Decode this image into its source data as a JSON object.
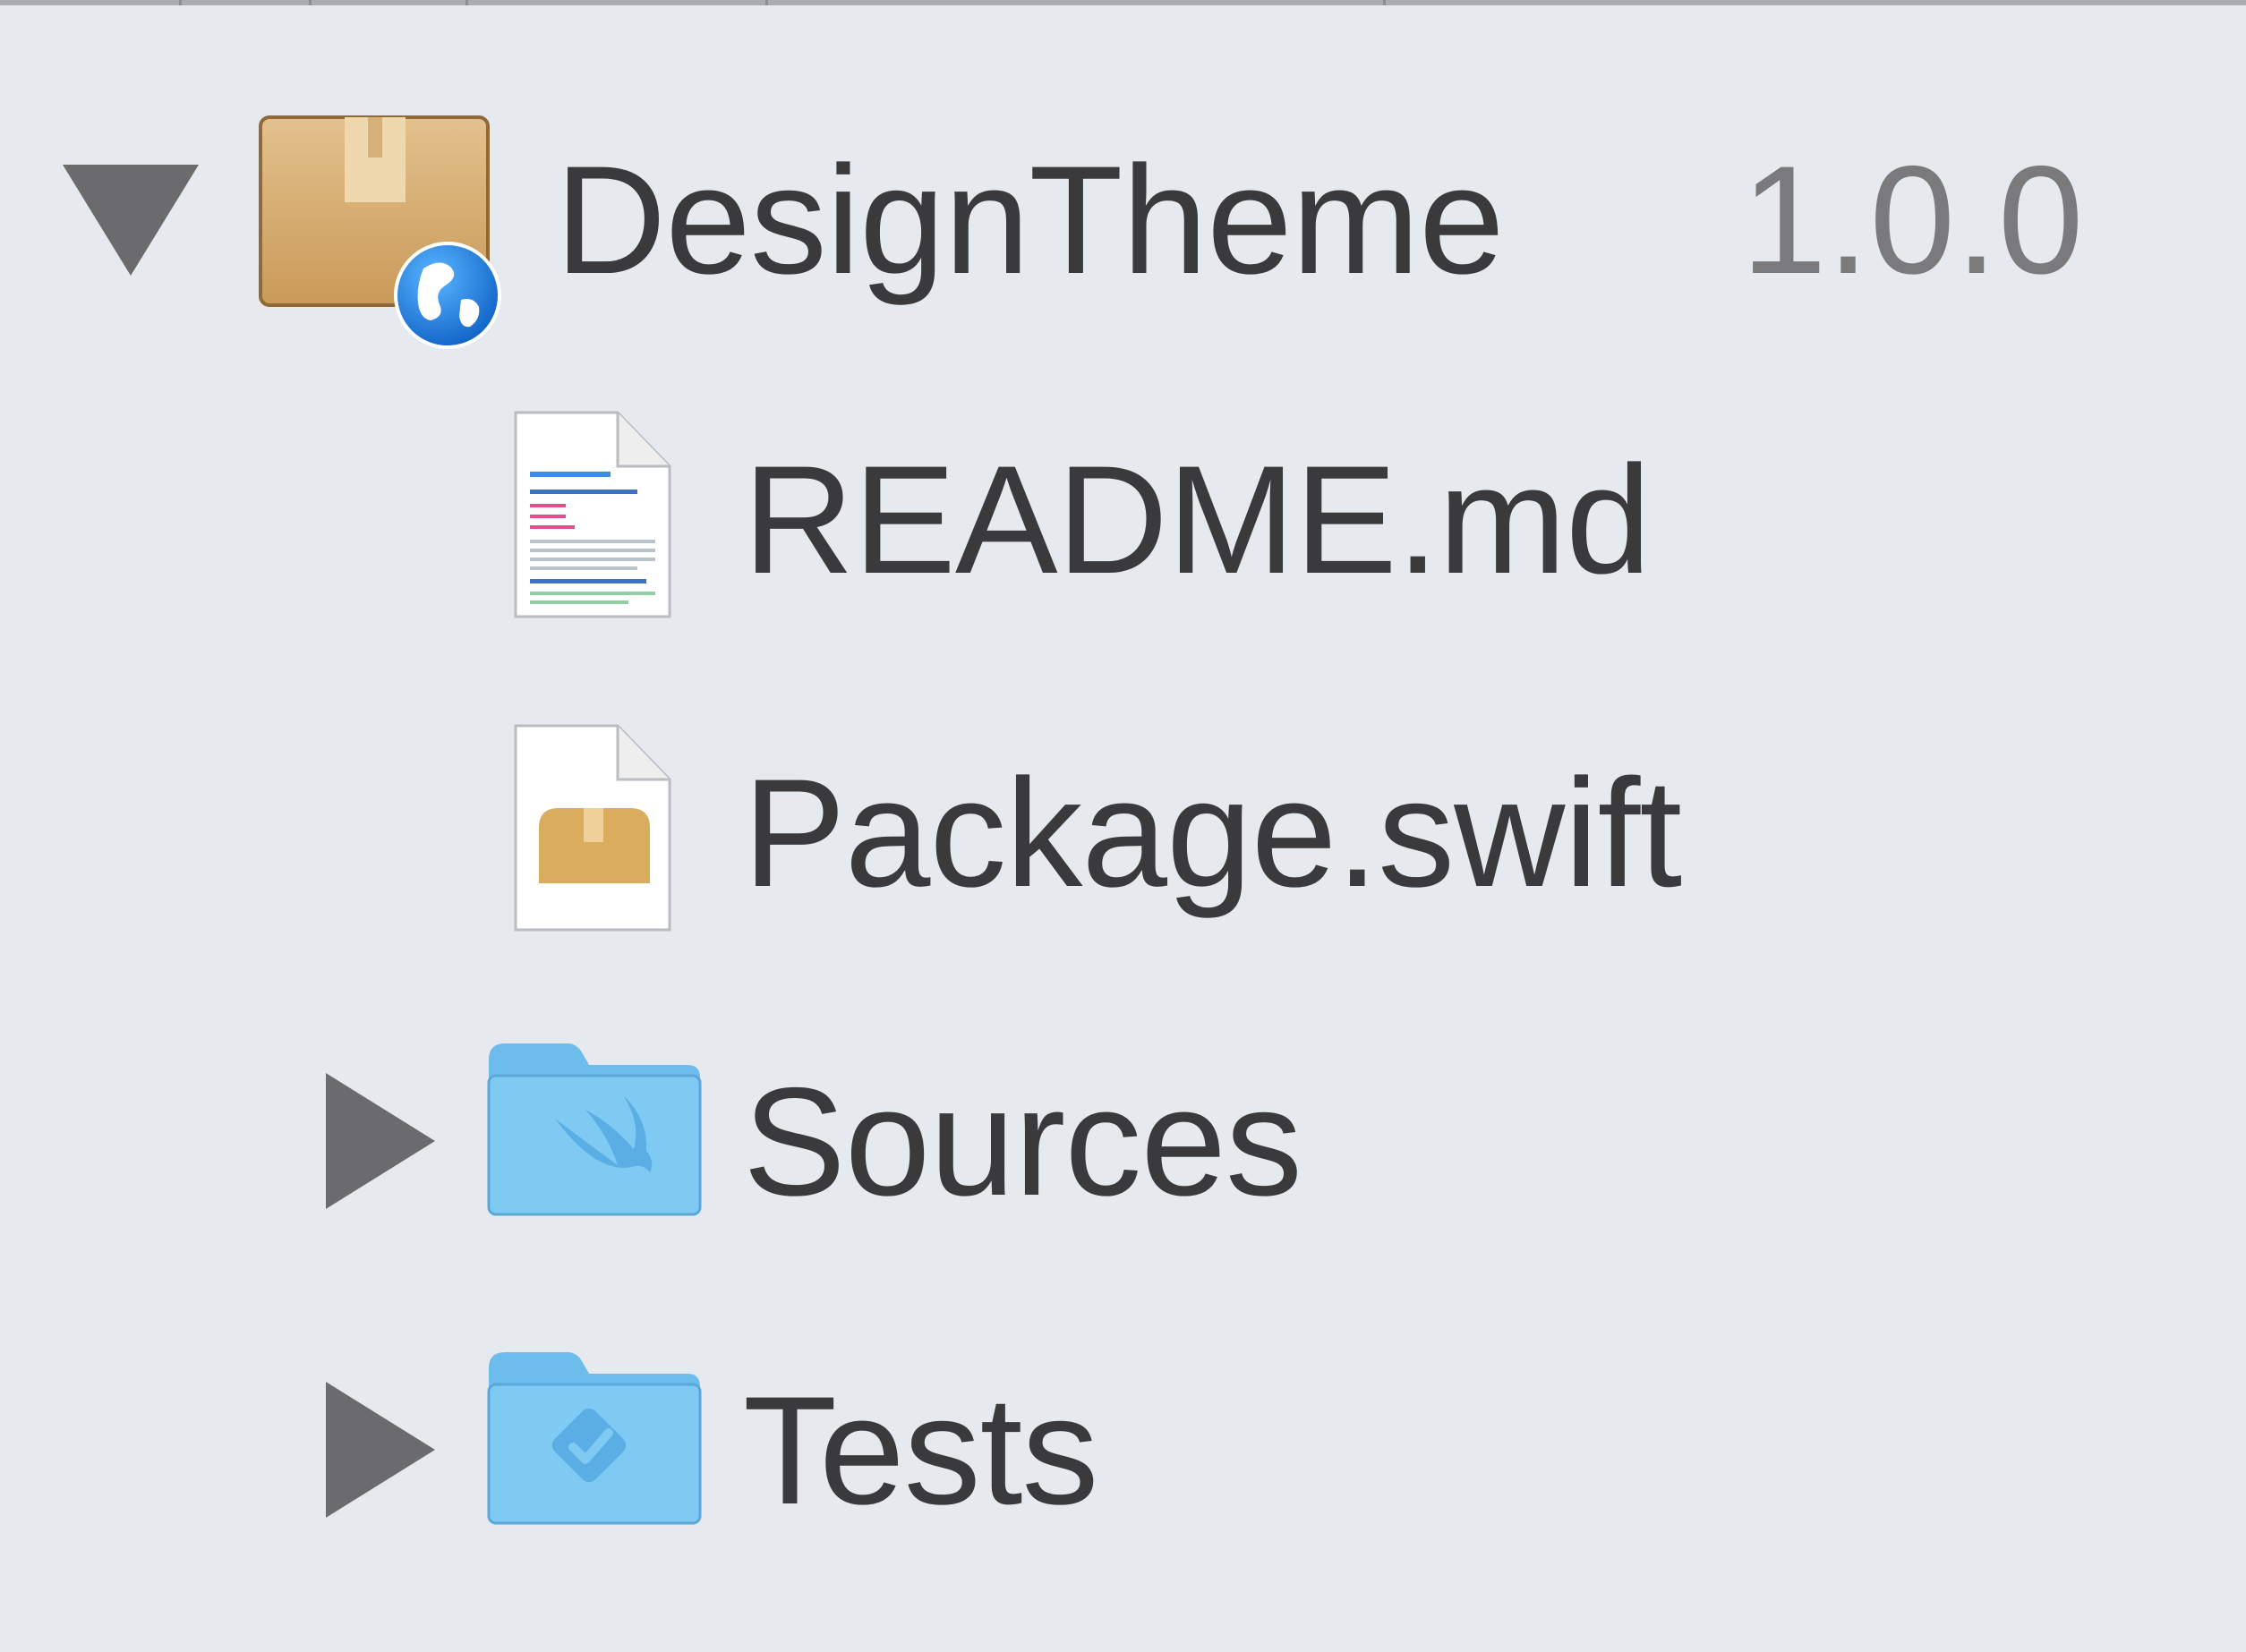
{
  "navigator": {
    "package": {
      "name": "DesignTheme",
      "version": "1.0.0",
      "icon": "package-globe-icon",
      "expanded": true
    },
    "items": [
      {
        "label": "README.md",
        "icon": "markdown-file-icon",
        "type": "file"
      },
      {
        "label": "Package.swift",
        "icon": "package-manifest-file-icon",
        "type": "file"
      },
      {
        "label": "Sources",
        "icon": "swift-folder-icon",
        "type": "folder",
        "expanded": false
      },
      {
        "label": "Tests",
        "icon": "tests-folder-icon",
        "type": "folder",
        "expanded": false
      }
    ],
    "colors": {
      "background": "#e6e9ed",
      "text": "#3a3a3c",
      "version_text": "#7a7a7c",
      "disclosure": "#6b6b6e",
      "folder_blue": "#7cc6f2",
      "package_tan": "#d7b27a"
    }
  }
}
